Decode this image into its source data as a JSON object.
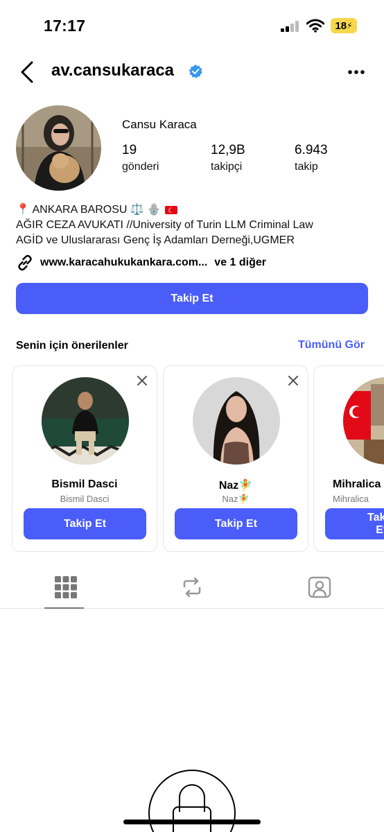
{
  "status_bar": {
    "time": "17:17",
    "battery": "18"
  },
  "header": {
    "username": "av.cansukaraca"
  },
  "profile": {
    "full_name": "Cansu Karaca",
    "stats": {
      "posts_value": "19",
      "posts_label": "gönderi",
      "followers_value": "12,9B",
      "followers_label": "takipçi",
      "following_value": "6.943",
      "following_label": "takip"
    },
    "bio": {
      "line1": "📍 ANKARA BAROSU ⚖️ 🪬",
      "line2": "AĞIR CEZA AVUKATI //University of Turin LLM Criminal Law",
      "line3": "AGİD ve Uluslararası Genç İş Adamları Derneği,UGMER"
    },
    "link": {
      "text": "www.karacahukukankara.com...",
      "more": "ve 1 diğer"
    },
    "follow_label": "Takip Et"
  },
  "suggestions": {
    "title": "Senin için önerilenler",
    "see_all": "Tümünü Gör",
    "cards": [
      {
        "name": "Bismil Dasci",
        "subtitle": "Bismil Dasci",
        "follow_label": "Takip Et"
      },
      {
        "name": "Naz🧚",
        "subtitle": "Naz🧚",
        "follow_label": "Takip Et"
      },
      {
        "name": "Mihralica",
        "subtitle": "Mihralica",
        "follow_label": "Takip Et"
      }
    ]
  },
  "tabs": [
    "grid-icon",
    "reels-icon",
    "tagged-icon"
  ],
  "colors": {
    "accent": "#4a5df9",
    "battery": "#f5d84c",
    "verified": "#3897f0"
  }
}
